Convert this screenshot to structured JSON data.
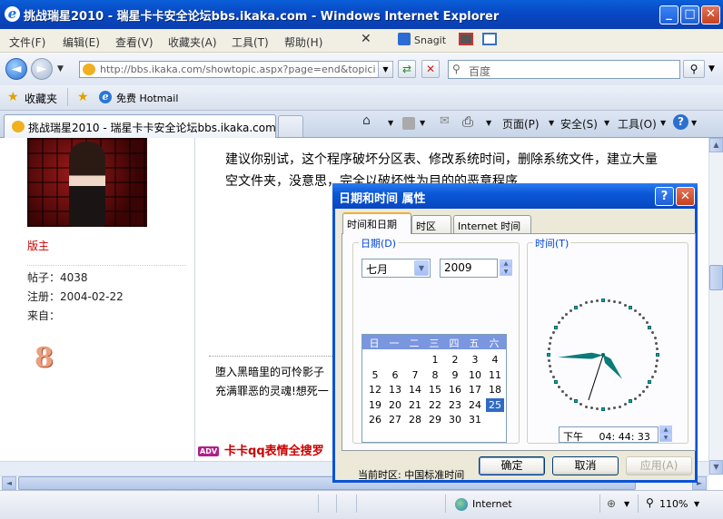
{
  "window": {
    "title": "挑战瑞星2010 - 瑞星卡卡安全论坛bbs.ikaka.com - Windows Internet Explorer"
  },
  "menu": {
    "items": [
      "文件(F)",
      "编辑(E)",
      "查看(V)",
      "收藏夹(A)",
      "工具(T)",
      "帮助(H)"
    ],
    "snagit": "Snagit"
  },
  "address": {
    "url": "http://bbs.ikaka.com/showtopic.aspx?page=end&topici",
    "search_placeholder": "百度"
  },
  "favorites": {
    "label": "收藏夹",
    "link": "免费 Hotmail"
  },
  "tabs": {
    "active": "挑战瑞星2010 - 瑞星卡卡安全论坛bbs.ikaka.com"
  },
  "commands": {
    "page": "页面(P)",
    "safety": "安全(S)",
    "tools": "工具(O)"
  },
  "post": {
    "role": "版主",
    "posts": "帖子：4038",
    "registered": "注册：2004-02-22",
    "from": "来自：",
    "badge": "8",
    "text": "建议你别试，这个程序破坏分区表、修改系统时间，删除系统文件，建立大量空文件夹，没意思，完全以破坏性为目的的恶意程序",
    "sig_line1": "堕入黑暗里的可怜影子",
    "sig_line2": "充满罪恶的灵魂!想死一",
    "adv_tag": "ADV",
    "adv_text": "卡卡qq表情全搜罗"
  },
  "status": {
    "zone": "Internet",
    "zoom": "110%"
  },
  "dialog": {
    "title": "日期和时间 属性",
    "tabs": [
      "时间和日期",
      "时区",
      "Internet 时间"
    ],
    "date_group": "日期(D)",
    "time_group": "时间(T)",
    "month": "七月",
    "year": "2009",
    "weekdays": [
      "日",
      "一",
      "二",
      "三",
      "四",
      "五",
      "六"
    ],
    "days": [
      "1",
      "2",
      "3",
      "4",
      "5",
      "6",
      "7",
      "8",
      "9",
      "10",
      "11",
      "12",
      "13",
      "14",
      "15",
      "16",
      "17",
      "18",
      "19",
      "20",
      "21",
      "22",
      "23",
      "24",
      "25",
      "26",
      "27",
      "28",
      "29",
      "30",
      "31"
    ],
    "selected_day": "25",
    "ampm": "下午",
    "time": "04: 44: 33",
    "timezone": "当前时区: 中国标准时间",
    "ok": "确定",
    "cancel": "取消",
    "apply": "应用(A)"
  }
}
